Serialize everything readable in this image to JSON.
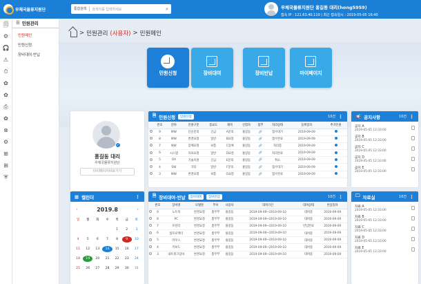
{
  "header": {
    "logo_text": "우체국물류지원단",
    "search_select": "통합검색",
    "search_placeholder": "검색어를 입력하세요",
    "user_name": "우체국물류지원단 홍길동 대리(hong5959)",
    "user_meta": "접속 IP : 121.63.40.110 | 최근 접속일시 : 2019-05-05 16:40"
  },
  "sidebar": {
    "title": "민원관리",
    "items": [
      "민원메인",
      "민원신청",
      "장비대여·반납"
    ],
    "active": 0
  },
  "iconbar": [
    "🗐",
    "⚙",
    "🎧",
    "⚠",
    "⏱",
    "✿",
    "✿",
    "⎙",
    "✿",
    "⊗",
    "⚙",
    "⊞",
    "⊞",
    "⛨"
  ],
  "breadcrumb": {
    "prefix": "민원관리",
    "tag": "(사용자)",
    "sep": ">",
    "current": "민원메인"
  },
  "quick": [
    {
      "label": "민원신청",
      "color": "#1d7fd7",
      "active": true
    },
    {
      "label": "장비대여",
      "color": "#3aa9e8"
    },
    {
      "label": "장비반납",
      "color": "#3aa9e8"
    },
    {
      "label": "마이페이지",
      "color": "#3aa9e8"
    }
  ],
  "profile": {
    "name": "홍길동 대리",
    "org": "우체국물류지원단",
    "button": "마이페이지바로가기"
  },
  "complaint": {
    "title": "민원신청",
    "tag": "민원신청",
    "count": "10건",
    "headers": [
      "번호",
      "분야",
      "민원구분",
      "중요도",
      "제목",
      "신청자",
      "첨부",
      "처리상태",
      "등록일자",
      "추가민원"
    ],
    "rows": [
      [
        "9",
        "MW",
        "단순문의",
        "긴급",
        "A문의",
        "홍길동",
        "",
        "접수대기",
        "2019-09-09"
      ],
      [
        "8",
        "MW",
        "변경요청",
        "일반",
        "B요청",
        "홍길동",
        "",
        "접수완료",
        "2019-09-09"
      ],
      [
        "7",
        "NW",
        "장애요청",
        "보통",
        "C장애",
        "홍길동",
        "",
        "처리중",
        "2019-09-09"
      ],
      [
        "6",
        "시스템",
        "자료요청",
        "일반",
        "D요청",
        "홍길동",
        "",
        "처리완료",
        "2019-09-09"
      ],
      [
        "5",
        "OA",
        "기술지원",
        "긴급",
        "E문의",
        "홍길동",
        "",
        "취소",
        "2019-09-09"
      ],
      [
        "4",
        "SW",
        "기타",
        "일반",
        "F문의",
        "홍길동",
        "",
        "접수대기",
        "2019-09-09"
      ],
      [
        "3",
        "MW",
        "변경요청",
        "보통",
        "G요청",
        "홍길동",
        "",
        "접수완료",
        "2019-09-09"
      ]
    ]
  },
  "equipment": {
    "title": "장비대여·반납",
    "tags": [
      "장비대여",
      "장비반납"
    ],
    "count": "10건",
    "headers": [
      "번호",
      "장비명",
      "모델명",
      "부서",
      "사용자",
      "대여기간",
      "대여상태",
      "반납일자"
    ],
    "rows": [
      [
        "9",
        "노트북",
        "변경요청",
        "총무부",
        "홍길동",
        "2019-09-09~2019-09-10",
        "대여중",
        "2019-09-09"
      ],
      [
        "8",
        "PC",
        "변경요청",
        "총무부",
        "홍길동",
        "2019-09-09~2019-09-10",
        "대여중",
        "2019-09-09"
      ],
      [
        "7",
        "프린터",
        "변경요청",
        "총무부",
        "홍길동",
        "2019-09-09~2019-09-10",
        "반납완료",
        "2019-09-09"
      ],
      [
        "6",
        "빔프로젝터",
        "변경요청",
        "총무부",
        "홍길동",
        "2019-09-09~2019-09-10",
        "대여중",
        "2019-09-09"
      ],
      [
        "5",
        "마우스",
        "변경요청",
        "총무부",
        "홍길동",
        "2019-09-09~2019-09-10",
        "대여중",
        "2019-09-09"
      ],
      [
        "4",
        "키보드",
        "변경요청",
        "총무부",
        "홍길동",
        "2019-09-09~2019-09-10",
        "대여중",
        "2019-09-09"
      ],
      [
        "3",
        "네트워크장비",
        "변경요청",
        "총무부",
        "홍길동",
        "2019-09-09~2019-09-10",
        "대여중",
        "2019-09-09"
      ]
    ]
  },
  "calendar": {
    "title": "캘린더",
    "month": "2019.8",
    "weekdays": [
      "일",
      "월",
      "화",
      "수",
      "목",
      "금",
      "토"
    ],
    "days": [
      "",
      "",
      "",
      "",
      "1",
      "2",
      "3",
      "4",
      "5",
      "6",
      "7",
      "8",
      "9",
      "10",
      "11",
      "12",
      "13",
      "14",
      "15",
      "16",
      "17",
      "18",
      "19",
      "20",
      "21",
      "22",
      "23",
      "24",
      "25",
      "26",
      "27",
      "28",
      "29",
      "30",
      "31"
    ]
  },
  "notice": {
    "title": "공지사항",
    "count": "10건",
    "items": [
      {
        "t": "공지 A",
        "d": "2019-05-05 12:33:00"
      },
      {
        "t": "공지 B",
        "d": "2019-05-05 12:33:00"
      },
      {
        "t": "공지 C",
        "d": "2019-05-05 12:33:00"
      },
      {
        "t": "공지 D",
        "d": "2019-05-05 12:33:00"
      },
      {
        "t": "공지 E",
        "d": "2019-05-05 12:33:00"
      }
    ]
  },
  "library": {
    "title": "자료실",
    "count": "10건",
    "items": [
      {
        "t": "자료 A",
        "d": "2019-05-05 12:33:00"
      },
      {
        "t": "자료 B",
        "d": "2019-05-05 12:33:00"
      },
      {
        "t": "자료 C",
        "d": "2019-05-05 12:33:00"
      },
      {
        "t": "자료 D",
        "d": "2019-05-05 12:33:00"
      },
      {
        "t": "자료 E",
        "d": "2019-05-05 12:33:00"
      }
    ]
  }
}
